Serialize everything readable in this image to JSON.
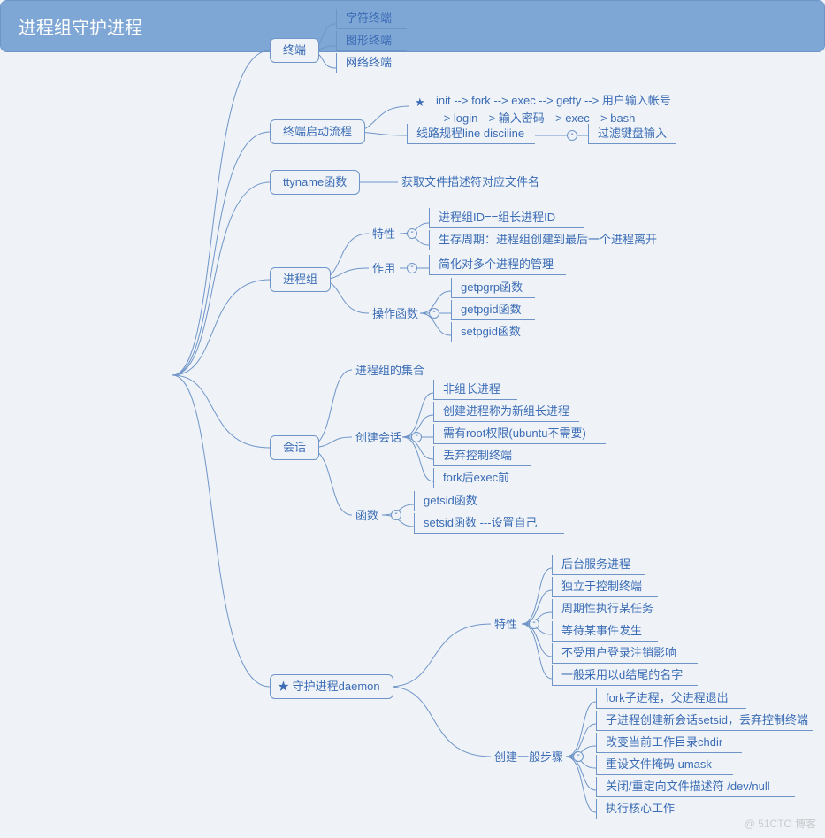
{
  "root": "进程组守护进程",
  "branches": {
    "terminal": {
      "label": "终端",
      "children": [
        "字符终端",
        "图形终端",
        "网络终端"
      ]
    },
    "startup": {
      "label": "终端启动流程",
      "flow_star": "★",
      "flow_text": "init --> fork --> exec --> getty --> 用户输入帐号\n--> login --> 输入密码 --> exec --> bash",
      "line_discipline": "线路规程line disciline",
      "filter": "过滤键盘输入"
    },
    "ttyname": {
      "label": "ttyname函数",
      "desc": "获取文件描述符对应文件名"
    },
    "pgroup": {
      "label": "进程组",
      "trait_label": "特性",
      "traits": [
        "进程组ID==组长进程ID",
        "生存周期：进程组创建到最后一个进程离开"
      ],
      "role_label": "作用",
      "role": "简化对多个进程的管理",
      "funcs_label": "操作函数",
      "funcs": [
        "getpgrp函数",
        "getpgid函数",
        "setpgid函数"
      ]
    },
    "session": {
      "label": "会话",
      "set_label": "进程组的集合",
      "create_label": "创建会话",
      "create": [
        "非组长进程",
        "创建进程称为新组长进程",
        "需有root权限(ubuntu不需要)",
        "丢弃控制终端",
        "fork后exec前"
      ],
      "funcs_label": "函数",
      "funcs": [
        "getsid函数",
        "setsid函数 ---设置自己"
      ]
    },
    "daemon": {
      "star": "★",
      "label": "守护进程daemon",
      "trait_label": "特性",
      "traits": [
        "后台服务进程",
        "独立于控制终端",
        "周期性执行某任务",
        "等待某事件发生",
        "不受用户登录注销影响",
        "一般采用以d结尾的名字"
      ],
      "steps_label": "创建一般步骤",
      "steps": [
        "fork子进程，父进程退出",
        "子进程创建新会话setsid，丢弃控制终端",
        "改变当前工作目录chdir",
        "重设文件掩码 umask",
        "关闭/重定向文件描述符 /dev/null",
        "执行核心工作"
      ]
    }
  },
  "watermark": "@ 51CTO 博客"
}
